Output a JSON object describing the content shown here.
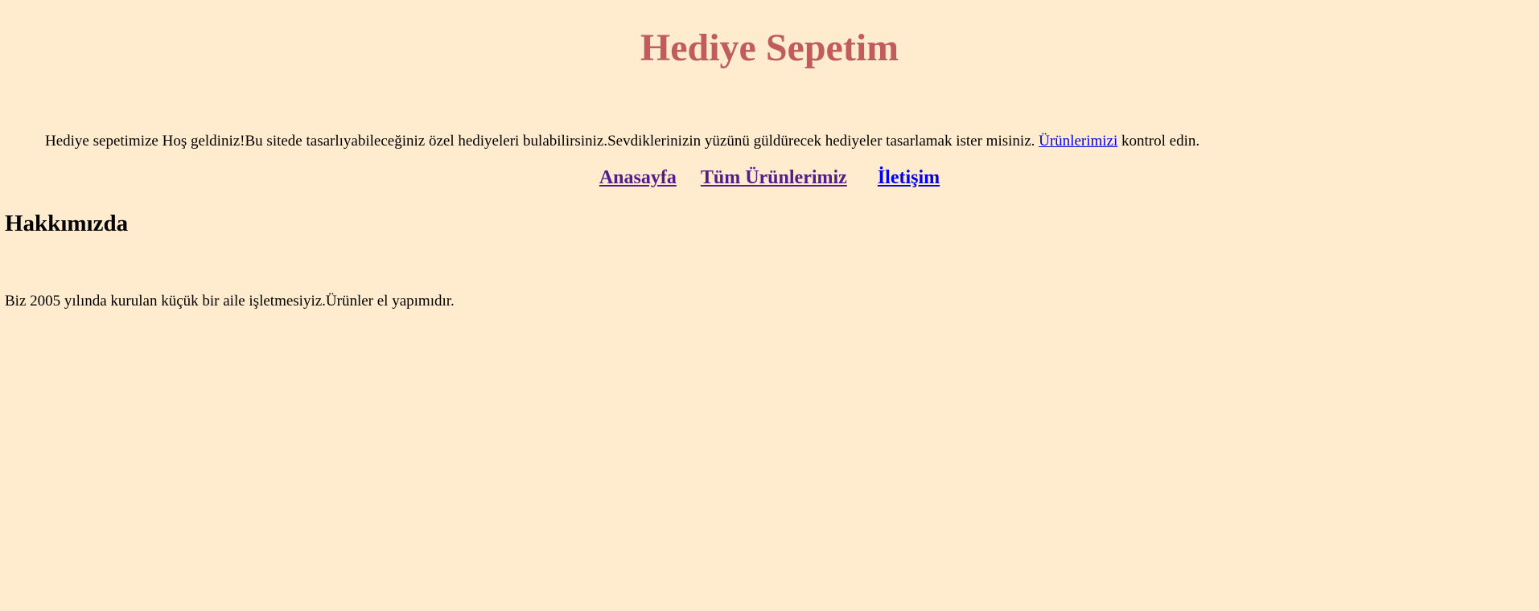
{
  "header": {
    "title": "Hediye Sepetim"
  },
  "welcome": {
    "text_before": "Hediye sepetimize Hoş geldiniz!Bu sitede tasarlıyabileceğiniz özel hediyeleri bulabilirsiniz.Sevdiklerinizin yüzünü güldürecek hediyeler tasarlamak ister misiniz. ",
    "link_label": "Ürünlerimizi",
    "text_after": " kontrol edin."
  },
  "nav": {
    "items": [
      {
        "label": "Anasayfa"
      },
      {
        "label": "Tüm Ürünlerimiz"
      },
      {
        "label": "İletişim"
      }
    ]
  },
  "about": {
    "heading": "Hakkımızda",
    "text": "Biz 2005 yılında kurulan küçük bir aile işletmesiyiz.Ürünler el yapımıdır."
  },
  "colors": {
    "background": "#ffebcd",
    "title": "#c05c5c",
    "link": "#0000ee",
    "visited_link": "#551a8b"
  }
}
